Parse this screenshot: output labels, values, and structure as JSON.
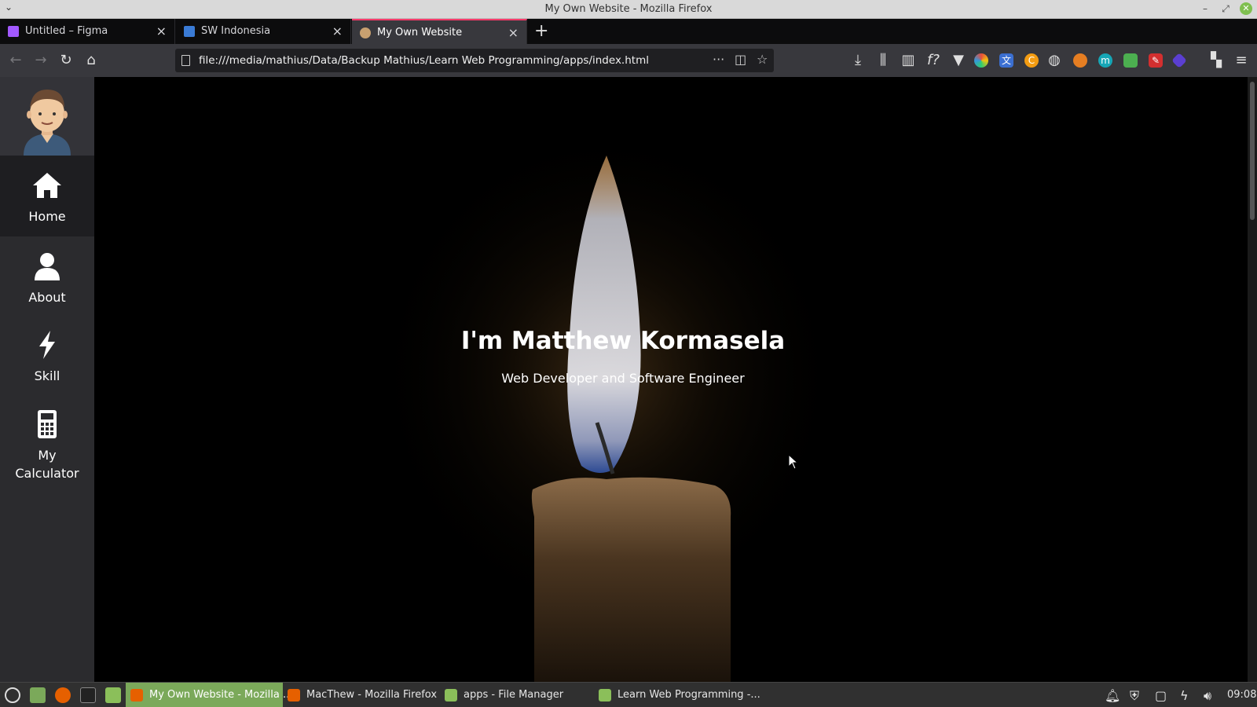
{
  "window": {
    "title": "My Own Website - Mozilla Firefox"
  },
  "tabs": [
    {
      "label": "Untitled – Figma",
      "icon": "figma-icon",
      "color": "#a259ff"
    },
    {
      "label": "SW Indonesia",
      "icon": "sw-indonesia-icon",
      "color": "#3a7bd5"
    },
    {
      "label": "My Own Website",
      "icon": "avatar-favicon",
      "color": "#c8a070",
      "active": true
    }
  ],
  "navbar": {
    "url": "file:///media/mathius/Data/Backup Mathius/Learn Web Programming/apps/index.html"
  },
  "sidebar": {
    "avatar": "avatar-icon",
    "items": [
      {
        "label": "Home",
        "icon": "home-icon",
        "active": true
      },
      {
        "label": "About",
        "icon": "user-icon"
      },
      {
        "label": "Skill",
        "icon": "lightning-icon"
      },
      {
        "label_line1": "My",
        "label_line2": "Calculator",
        "icon": "calculator-icon"
      }
    ]
  },
  "hero": {
    "title": "I'm Matthew Kormasela",
    "subtitle": "Web Developer and Software Engineer",
    "background": "candle-image"
  },
  "taskbar": {
    "tasks": [
      {
        "label": "My Own Website - Mozilla ...",
        "active": true
      },
      {
        "label": "MacThew - Mozilla Firefox"
      },
      {
        "label": "apps - File Manager"
      },
      {
        "label": "Learn Web Programming -..."
      }
    ],
    "clock": "09:08"
  },
  "colors": {
    "accent_tab": "#ff3b6b",
    "taskbar_active": "#7ba95a",
    "sidebar_bg": "#2b2b2e"
  }
}
